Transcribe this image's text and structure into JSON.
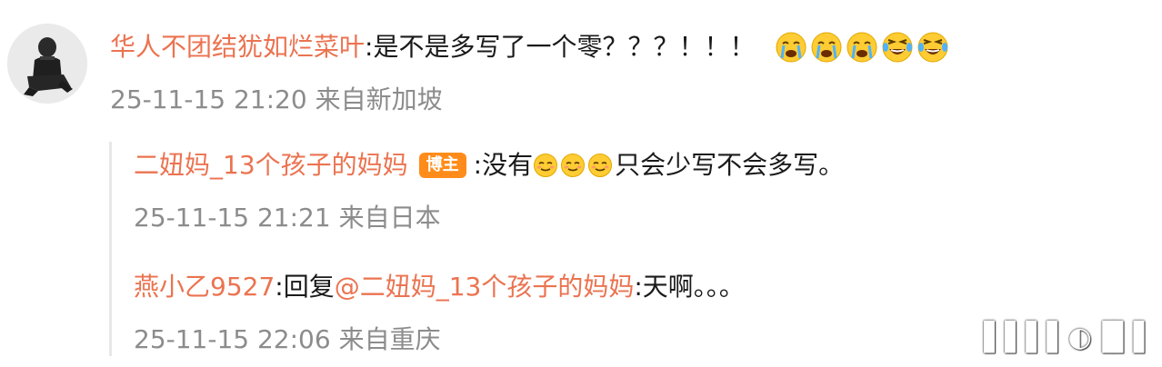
{
  "main_comment": {
    "username": "华人不团结犹如烂菜叶",
    "separator": ":",
    "text": "是不是多写了一个零？？？！！！",
    "emojis": [
      "crying-emoji",
      "crying-emoji",
      "crying-emoji",
      "laughing-tears-emoji",
      "laughing-tears-emoji"
    ],
    "time": "25-11-15 21:20",
    "location": "来自新加坡"
  },
  "replies": [
    {
      "username": "二妞妈_13个孩子的妈妈",
      "badge": "博主",
      "separator": ":",
      "text_before": "没有",
      "emojis": [
        "smug-emoji",
        "smug-emoji",
        "smug-emoji"
      ],
      "text_after": "只会少写不会多写。",
      "time": "25-11-15 21:21",
      "location": "来自日本"
    },
    {
      "username": "燕小乙9527",
      "separator": ":",
      "reply_prefix": "回复",
      "mention": "@二妞妈_13个孩子的妈妈",
      "separator2": ":",
      "text": "天啊。。。",
      "time": "25-11-15 22:06",
      "location": "来自重庆"
    }
  ],
  "colors": {
    "username": "#eb7350",
    "text": "#1a1a1a",
    "meta": "#8c8c8c",
    "badge_bg": "#ff8c1a"
  }
}
